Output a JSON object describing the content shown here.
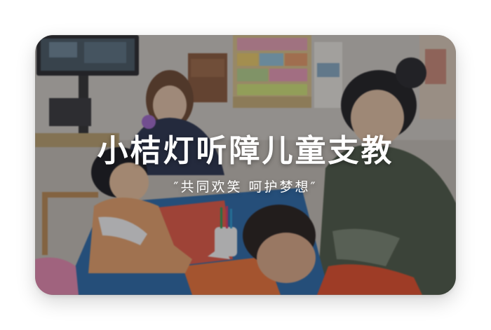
{
  "banner": {
    "title": "小桔灯听障儿童支教",
    "subtitle": "″共同欢笑  呵护梦想″"
  }
}
